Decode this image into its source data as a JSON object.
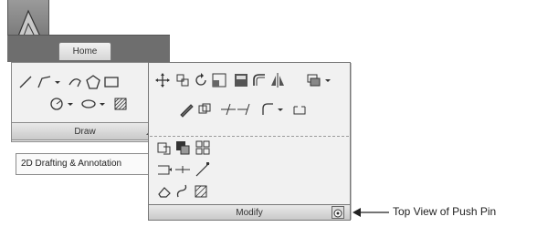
{
  "ribbon": {
    "tab_home": "Home"
  },
  "panels": {
    "draw": {
      "title": "Draw"
    },
    "modify": {
      "title": "Modify"
    }
  },
  "workspace": {
    "value": "2D Drafting & Annotation"
  },
  "callout": {
    "text": "Top View of Push Pin"
  },
  "icons": [
    "line-icon",
    "polyline-icon",
    "arc-icon",
    "polygon-icon",
    "rectangle-icon",
    "circle-icon",
    "ellipse-icon",
    "hatch-icon",
    "move-icon",
    "copy-icon",
    "rotate-icon",
    "scale-icon",
    "array-icon",
    "offset-icon",
    "mirror-icon",
    "layer-icon",
    "pen-icon",
    "stretch-icon",
    "trim-icon",
    "extend-icon",
    "fillet-icon",
    "explode-icon",
    "chamfer-icon",
    "match-icon",
    "grid-icon",
    "lengthen-icon",
    "join-icon",
    "break-icon",
    "erase-icon",
    "edit-icon"
  ]
}
